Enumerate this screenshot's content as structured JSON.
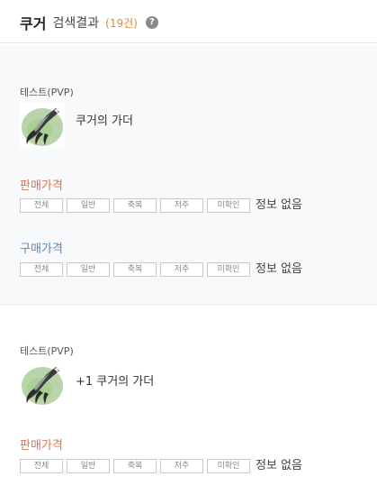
{
  "header": {
    "query": "쿠거",
    "title": "검색결과",
    "count": "(19건)",
    "help": "?"
  },
  "results": [
    {
      "server": "테스트(PVP)",
      "icon": "claw-weapon-icon",
      "name": "쿠거의 가더",
      "sell": {
        "title": "판매가격",
        "tags": [
          "전체",
          "일반",
          "축복",
          "저주",
          "미확인"
        ],
        "status": "정보 없음"
      },
      "buy": {
        "title": "구매가격",
        "tags": [
          "전체",
          "일반",
          "축복",
          "저주",
          "미확인"
        ],
        "status": "정보 없음"
      }
    },
    {
      "server": "테스트(PVP)",
      "icon": "claw-weapon-icon",
      "name": "+1 쿠거의 가더",
      "sell": {
        "title": "판매가격",
        "tags": [
          "전체",
          "일반",
          "축복",
          "저주",
          "미확인"
        ],
        "status": "정보 없음"
      }
    }
  ],
  "colors": {
    "sell": "#e0714f",
    "buy": "#5b86b8",
    "count": "#e08a3a"
  }
}
